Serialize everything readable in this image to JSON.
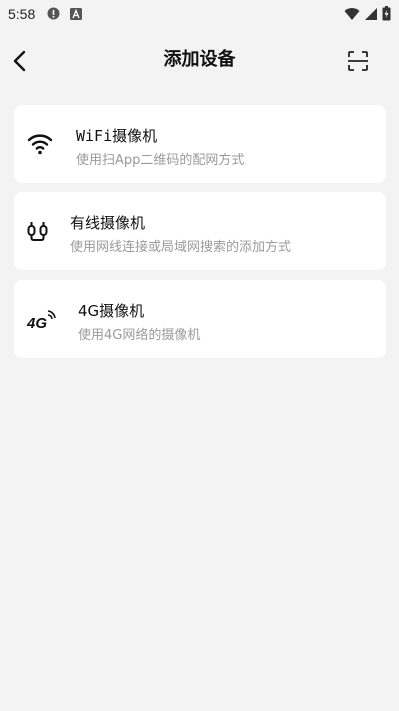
{
  "status_bar": {
    "time": "5:58",
    "icons": [
      "alert-icon",
      "font-icon",
      "wifi-icon",
      "signal-icon",
      "battery-icon"
    ]
  },
  "header": {
    "title": "添加设备",
    "back_icon": "chevron-left-icon",
    "scan_icon": "scan-icon"
  },
  "options": [
    {
      "title": "WiFi摄像机",
      "subtitle": "使用扫App二维码的配网方式",
      "icon": "wifi-icon"
    },
    {
      "title": "有线摄像机",
      "subtitle": "使用网线连接或局域网搜索的添加方式",
      "icon": "cable-plug-icon"
    },
    {
      "title": "4G摄像机",
      "subtitle": "使用4G网络的摄像机",
      "icon": "4g-icon"
    }
  ]
}
